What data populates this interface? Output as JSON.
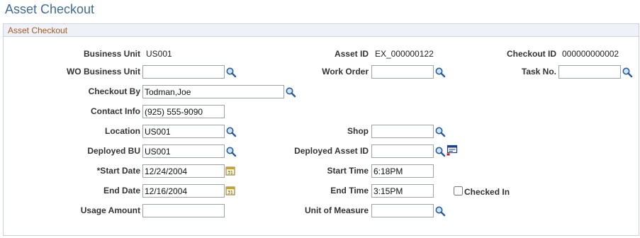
{
  "page": {
    "title": "Asset Checkout"
  },
  "group": {
    "title": "Asset Checkout"
  },
  "fields": {
    "business_unit": {
      "label": "Business Unit",
      "value": "US001"
    },
    "asset_id": {
      "label": "Asset ID",
      "value": "EX_000000122"
    },
    "checkout_id": {
      "label": "Checkout ID",
      "value": "000000000002"
    },
    "wo_business_unit": {
      "label": "WO Business Unit",
      "value": ""
    },
    "work_order": {
      "label": "Work Order",
      "value": ""
    },
    "task_no": {
      "label": "Task No.",
      "value": ""
    },
    "checkout_by": {
      "label": "Checkout By",
      "value": "Todman,Joe"
    },
    "contact_info": {
      "label": "Contact Info",
      "value": "(925) 555-9090"
    },
    "location": {
      "label": "Location",
      "value": "US001"
    },
    "shop": {
      "label": "Shop",
      "value": ""
    },
    "deployed_bu": {
      "label": "Deployed BU",
      "value": "US001"
    },
    "deployed_asset_id": {
      "label": "Deployed Asset ID",
      "value": ""
    },
    "start_date": {
      "label": "*Start Date",
      "value": "12/24/2004"
    },
    "start_time": {
      "label": "Start Time",
      "value": "6:18PM"
    },
    "end_date": {
      "label": "End Date",
      "value": "12/16/2004"
    },
    "end_time": {
      "label": "End Time",
      "value": "3:15PM"
    },
    "checked_in": {
      "label": "Checked In",
      "checked": false
    },
    "usage_amount": {
      "label": "Usage Amount",
      "value": ""
    },
    "unit_of_measure": {
      "label": "Unit of Measure",
      "value": ""
    }
  },
  "icons": {
    "lookup": "magnifier-lookup-icon",
    "calendar": "calendar-icon",
    "detail": "asset-detail-icon"
  },
  "colors": {
    "title": "#3f6a9a",
    "group_title": "#a55a1e",
    "group_header_bg": "#eef2f8",
    "border": "#c9d2dd"
  }
}
